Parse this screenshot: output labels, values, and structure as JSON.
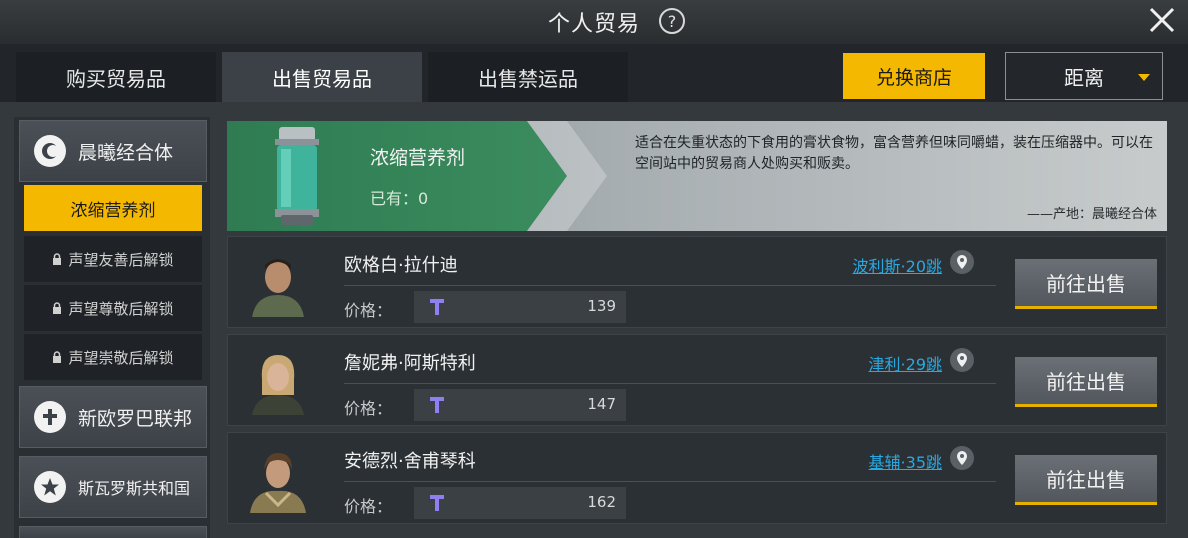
{
  "header": {
    "title": "个人贸易",
    "help_symbol": "?",
    "close_icon": "close-icon"
  },
  "tabs": [
    {
      "label": "购买贸易品",
      "active": false
    },
    {
      "label": "出售贸易品",
      "active": true
    },
    {
      "label": "出售禁运品",
      "active": false
    }
  ],
  "toolbar": {
    "exchange_label": "兑换商店",
    "sort_label": "距离"
  },
  "sidebar": {
    "factions": [
      {
        "label": "晨曦经合体",
        "icon": "crescent-icon"
      },
      {
        "label": "新欧罗巴联邦",
        "icon": "cross-icon"
      },
      {
        "label": "斯瓦罗斯共和国",
        "icon": "star-icon"
      }
    ],
    "sub_items": [
      {
        "label": "浓缩营养剂",
        "active": true,
        "locked": false
      },
      {
        "label": "声望友善后解锁",
        "active": false,
        "locked": true
      },
      {
        "label": "声望尊敬后解锁",
        "active": false,
        "locked": true
      },
      {
        "label": "声望崇敬后解锁",
        "active": false,
        "locked": true
      }
    ]
  },
  "product": {
    "name": "浓缩营养剂",
    "owned": "已有：0",
    "description": "适合在失重状态的下食用的膏状食物，富含营养但味同嚼蜡，装在压缩器中。可以在空间站中的贸易商人处购买和贩卖。",
    "origin": "——产地：晨曦经合体"
  },
  "merchants": [
    {
      "name": "欧格白·拉什迪",
      "price_label": "价格：",
      "price": "139",
      "location": "波利斯·20跳",
      "action": "前往出售"
    },
    {
      "name": "詹妮弗·阿斯特利",
      "price_label": "价格：",
      "price": "147",
      "location": "津利·29跳",
      "action": "前往出售"
    },
    {
      "name": "安德烈·舍甫琴科",
      "price_label": "价格：",
      "price": "162",
      "location": "基辅·35跳",
      "action": "前往出售"
    }
  ],
  "colors": {
    "accent": "#f5b800",
    "link": "#2aa8e0",
    "banner_green": "#3b8c5e"
  }
}
